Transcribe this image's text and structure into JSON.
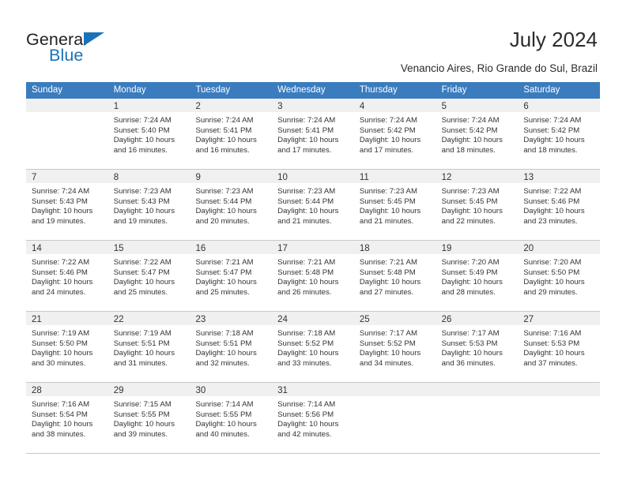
{
  "brand": {
    "name_part1": "General",
    "name_part2": "Blue",
    "triangle_color": "#1a72b8"
  },
  "header": {
    "title": "July 2024",
    "subtitle": "Venancio Aires, Rio Grande do Sul, Brazil",
    "accent_color": "#3a7cbe"
  },
  "calendar": {
    "weekday_headers": [
      "Sunday",
      "Monday",
      "Tuesday",
      "Wednesday",
      "Thursday",
      "Friday",
      "Saturday"
    ],
    "weeks": [
      [
        {
          "day": "",
          "sunrise": "",
          "sunset": "",
          "daylight_line1": "",
          "daylight_line2": ""
        },
        {
          "day": "1",
          "sunrise": "Sunrise: 7:24 AM",
          "sunset": "Sunset: 5:40 PM",
          "daylight_line1": "Daylight: 10 hours",
          "daylight_line2": "and 16 minutes."
        },
        {
          "day": "2",
          "sunrise": "Sunrise: 7:24 AM",
          "sunset": "Sunset: 5:41 PM",
          "daylight_line1": "Daylight: 10 hours",
          "daylight_line2": "and 16 minutes."
        },
        {
          "day": "3",
          "sunrise": "Sunrise: 7:24 AM",
          "sunset": "Sunset: 5:41 PM",
          "daylight_line1": "Daylight: 10 hours",
          "daylight_line2": "and 17 minutes."
        },
        {
          "day": "4",
          "sunrise": "Sunrise: 7:24 AM",
          "sunset": "Sunset: 5:42 PM",
          "daylight_line1": "Daylight: 10 hours",
          "daylight_line2": "and 17 minutes."
        },
        {
          "day": "5",
          "sunrise": "Sunrise: 7:24 AM",
          "sunset": "Sunset: 5:42 PM",
          "daylight_line1": "Daylight: 10 hours",
          "daylight_line2": "and 18 minutes."
        },
        {
          "day": "6",
          "sunrise": "Sunrise: 7:24 AM",
          "sunset": "Sunset: 5:42 PM",
          "daylight_line1": "Daylight: 10 hours",
          "daylight_line2": "and 18 minutes."
        }
      ],
      [
        {
          "day": "7",
          "sunrise": "Sunrise: 7:24 AM",
          "sunset": "Sunset: 5:43 PM",
          "daylight_line1": "Daylight: 10 hours",
          "daylight_line2": "and 19 minutes."
        },
        {
          "day": "8",
          "sunrise": "Sunrise: 7:23 AM",
          "sunset": "Sunset: 5:43 PM",
          "daylight_line1": "Daylight: 10 hours",
          "daylight_line2": "and 19 minutes."
        },
        {
          "day": "9",
          "sunrise": "Sunrise: 7:23 AM",
          "sunset": "Sunset: 5:44 PM",
          "daylight_line1": "Daylight: 10 hours",
          "daylight_line2": "and 20 minutes."
        },
        {
          "day": "10",
          "sunrise": "Sunrise: 7:23 AM",
          "sunset": "Sunset: 5:44 PM",
          "daylight_line1": "Daylight: 10 hours",
          "daylight_line2": "and 21 minutes."
        },
        {
          "day": "11",
          "sunrise": "Sunrise: 7:23 AM",
          "sunset": "Sunset: 5:45 PM",
          "daylight_line1": "Daylight: 10 hours",
          "daylight_line2": "and 21 minutes."
        },
        {
          "day": "12",
          "sunrise": "Sunrise: 7:23 AM",
          "sunset": "Sunset: 5:45 PM",
          "daylight_line1": "Daylight: 10 hours",
          "daylight_line2": "and 22 minutes."
        },
        {
          "day": "13",
          "sunrise": "Sunrise: 7:22 AM",
          "sunset": "Sunset: 5:46 PM",
          "daylight_line1": "Daylight: 10 hours",
          "daylight_line2": "and 23 minutes."
        }
      ],
      [
        {
          "day": "14",
          "sunrise": "Sunrise: 7:22 AM",
          "sunset": "Sunset: 5:46 PM",
          "daylight_line1": "Daylight: 10 hours",
          "daylight_line2": "and 24 minutes."
        },
        {
          "day": "15",
          "sunrise": "Sunrise: 7:22 AM",
          "sunset": "Sunset: 5:47 PM",
          "daylight_line1": "Daylight: 10 hours",
          "daylight_line2": "and 25 minutes."
        },
        {
          "day": "16",
          "sunrise": "Sunrise: 7:21 AM",
          "sunset": "Sunset: 5:47 PM",
          "daylight_line1": "Daylight: 10 hours",
          "daylight_line2": "and 25 minutes."
        },
        {
          "day": "17",
          "sunrise": "Sunrise: 7:21 AM",
          "sunset": "Sunset: 5:48 PM",
          "daylight_line1": "Daylight: 10 hours",
          "daylight_line2": "and 26 minutes."
        },
        {
          "day": "18",
          "sunrise": "Sunrise: 7:21 AM",
          "sunset": "Sunset: 5:48 PM",
          "daylight_line1": "Daylight: 10 hours",
          "daylight_line2": "and 27 minutes."
        },
        {
          "day": "19",
          "sunrise": "Sunrise: 7:20 AM",
          "sunset": "Sunset: 5:49 PM",
          "daylight_line1": "Daylight: 10 hours",
          "daylight_line2": "and 28 minutes."
        },
        {
          "day": "20",
          "sunrise": "Sunrise: 7:20 AM",
          "sunset": "Sunset: 5:50 PM",
          "daylight_line1": "Daylight: 10 hours",
          "daylight_line2": "and 29 minutes."
        }
      ],
      [
        {
          "day": "21",
          "sunrise": "Sunrise: 7:19 AM",
          "sunset": "Sunset: 5:50 PM",
          "daylight_line1": "Daylight: 10 hours",
          "daylight_line2": "and 30 minutes."
        },
        {
          "day": "22",
          "sunrise": "Sunrise: 7:19 AM",
          "sunset": "Sunset: 5:51 PM",
          "daylight_line1": "Daylight: 10 hours",
          "daylight_line2": "and 31 minutes."
        },
        {
          "day": "23",
          "sunrise": "Sunrise: 7:18 AM",
          "sunset": "Sunset: 5:51 PM",
          "daylight_line1": "Daylight: 10 hours",
          "daylight_line2": "and 32 minutes."
        },
        {
          "day": "24",
          "sunrise": "Sunrise: 7:18 AM",
          "sunset": "Sunset: 5:52 PM",
          "daylight_line1": "Daylight: 10 hours",
          "daylight_line2": "and 33 minutes."
        },
        {
          "day": "25",
          "sunrise": "Sunrise: 7:17 AM",
          "sunset": "Sunset: 5:52 PM",
          "daylight_line1": "Daylight: 10 hours",
          "daylight_line2": "and 34 minutes."
        },
        {
          "day": "26",
          "sunrise": "Sunrise: 7:17 AM",
          "sunset": "Sunset: 5:53 PM",
          "daylight_line1": "Daylight: 10 hours",
          "daylight_line2": "and 36 minutes."
        },
        {
          "day": "27",
          "sunrise": "Sunrise: 7:16 AM",
          "sunset": "Sunset: 5:53 PM",
          "daylight_line1": "Daylight: 10 hours",
          "daylight_line2": "and 37 minutes."
        }
      ],
      [
        {
          "day": "28",
          "sunrise": "Sunrise: 7:16 AM",
          "sunset": "Sunset: 5:54 PM",
          "daylight_line1": "Daylight: 10 hours",
          "daylight_line2": "and 38 minutes."
        },
        {
          "day": "29",
          "sunrise": "Sunrise: 7:15 AM",
          "sunset": "Sunset: 5:55 PM",
          "daylight_line1": "Daylight: 10 hours",
          "daylight_line2": "and 39 minutes."
        },
        {
          "day": "30",
          "sunrise": "Sunrise: 7:14 AM",
          "sunset": "Sunset: 5:55 PM",
          "daylight_line1": "Daylight: 10 hours",
          "daylight_line2": "and 40 minutes."
        },
        {
          "day": "31",
          "sunrise": "Sunrise: 7:14 AM",
          "sunset": "Sunset: 5:56 PM",
          "daylight_line1": "Daylight: 10 hours",
          "daylight_line2": "and 42 minutes."
        },
        {
          "day": "",
          "sunrise": "",
          "sunset": "",
          "daylight_line1": "",
          "daylight_line2": ""
        },
        {
          "day": "",
          "sunrise": "",
          "sunset": "",
          "daylight_line1": "",
          "daylight_line2": ""
        },
        {
          "day": "",
          "sunrise": "",
          "sunset": "",
          "daylight_line1": "",
          "daylight_line2": ""
        }
      ]
    ]
  }
}
